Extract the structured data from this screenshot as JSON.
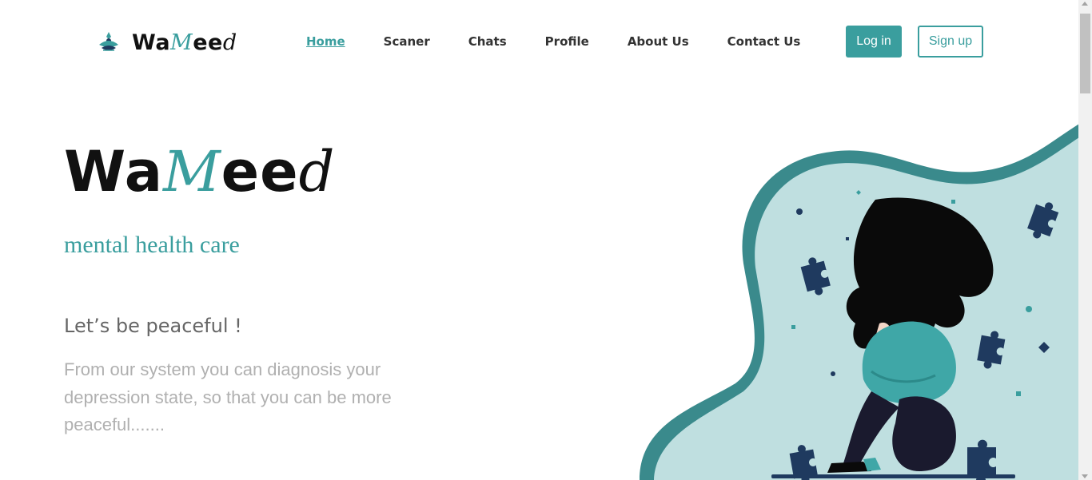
{
  "brand": {
    "logo_part1": "Wa",
    "logo_part2": "M",
    "logo_part3": "ee",
    "logo_part4": "d"
  },
  "nav": {
    "items": [
      {
        "label": "Home",
        "active": true
      },
      {
        "label": "Scaner",
        "active": false
      },
      {
        "label": "Chats",
        "active": false
      },
      {
        "label": "Profile",
        "active": false
      },
      {
        "label": "About Us",
        "active": false
      },
      {
        "label": "Contact Us",
        "active": false
      }
    ]
  },
  "auth": {
    "login_label": "Log in",
    "signup_label": "Sign up"
  },
  "hero": {
    "title_part1": "Wa",
    "title_part2": "M",
    "title_part3": "ee",
    "title_part4": "d",
    "subtitle": "mental health care",
    "tagline": "Let’s be peaceful !",
    "description": "From our system you can diagnosis your depression state, so that you can be more peaceful......."
  },
  "colors": {
    "accent": "#3a9e9e",
    "blob_light": "#bfdfe0",
    "blob_dark": "#3a8a8c",
    "puzzle": "#1f3a5f",
    "hair": "#0a0a0a",
    "hoodie": "#3fa7a7",
    "pants": "#1a1a2e"
  },
  "icons": {
    "logo_icon": "lotus-meditation-icon",
    "illustration": "sad-girl-with-puzzle-pieces-illustration"
  }
}
